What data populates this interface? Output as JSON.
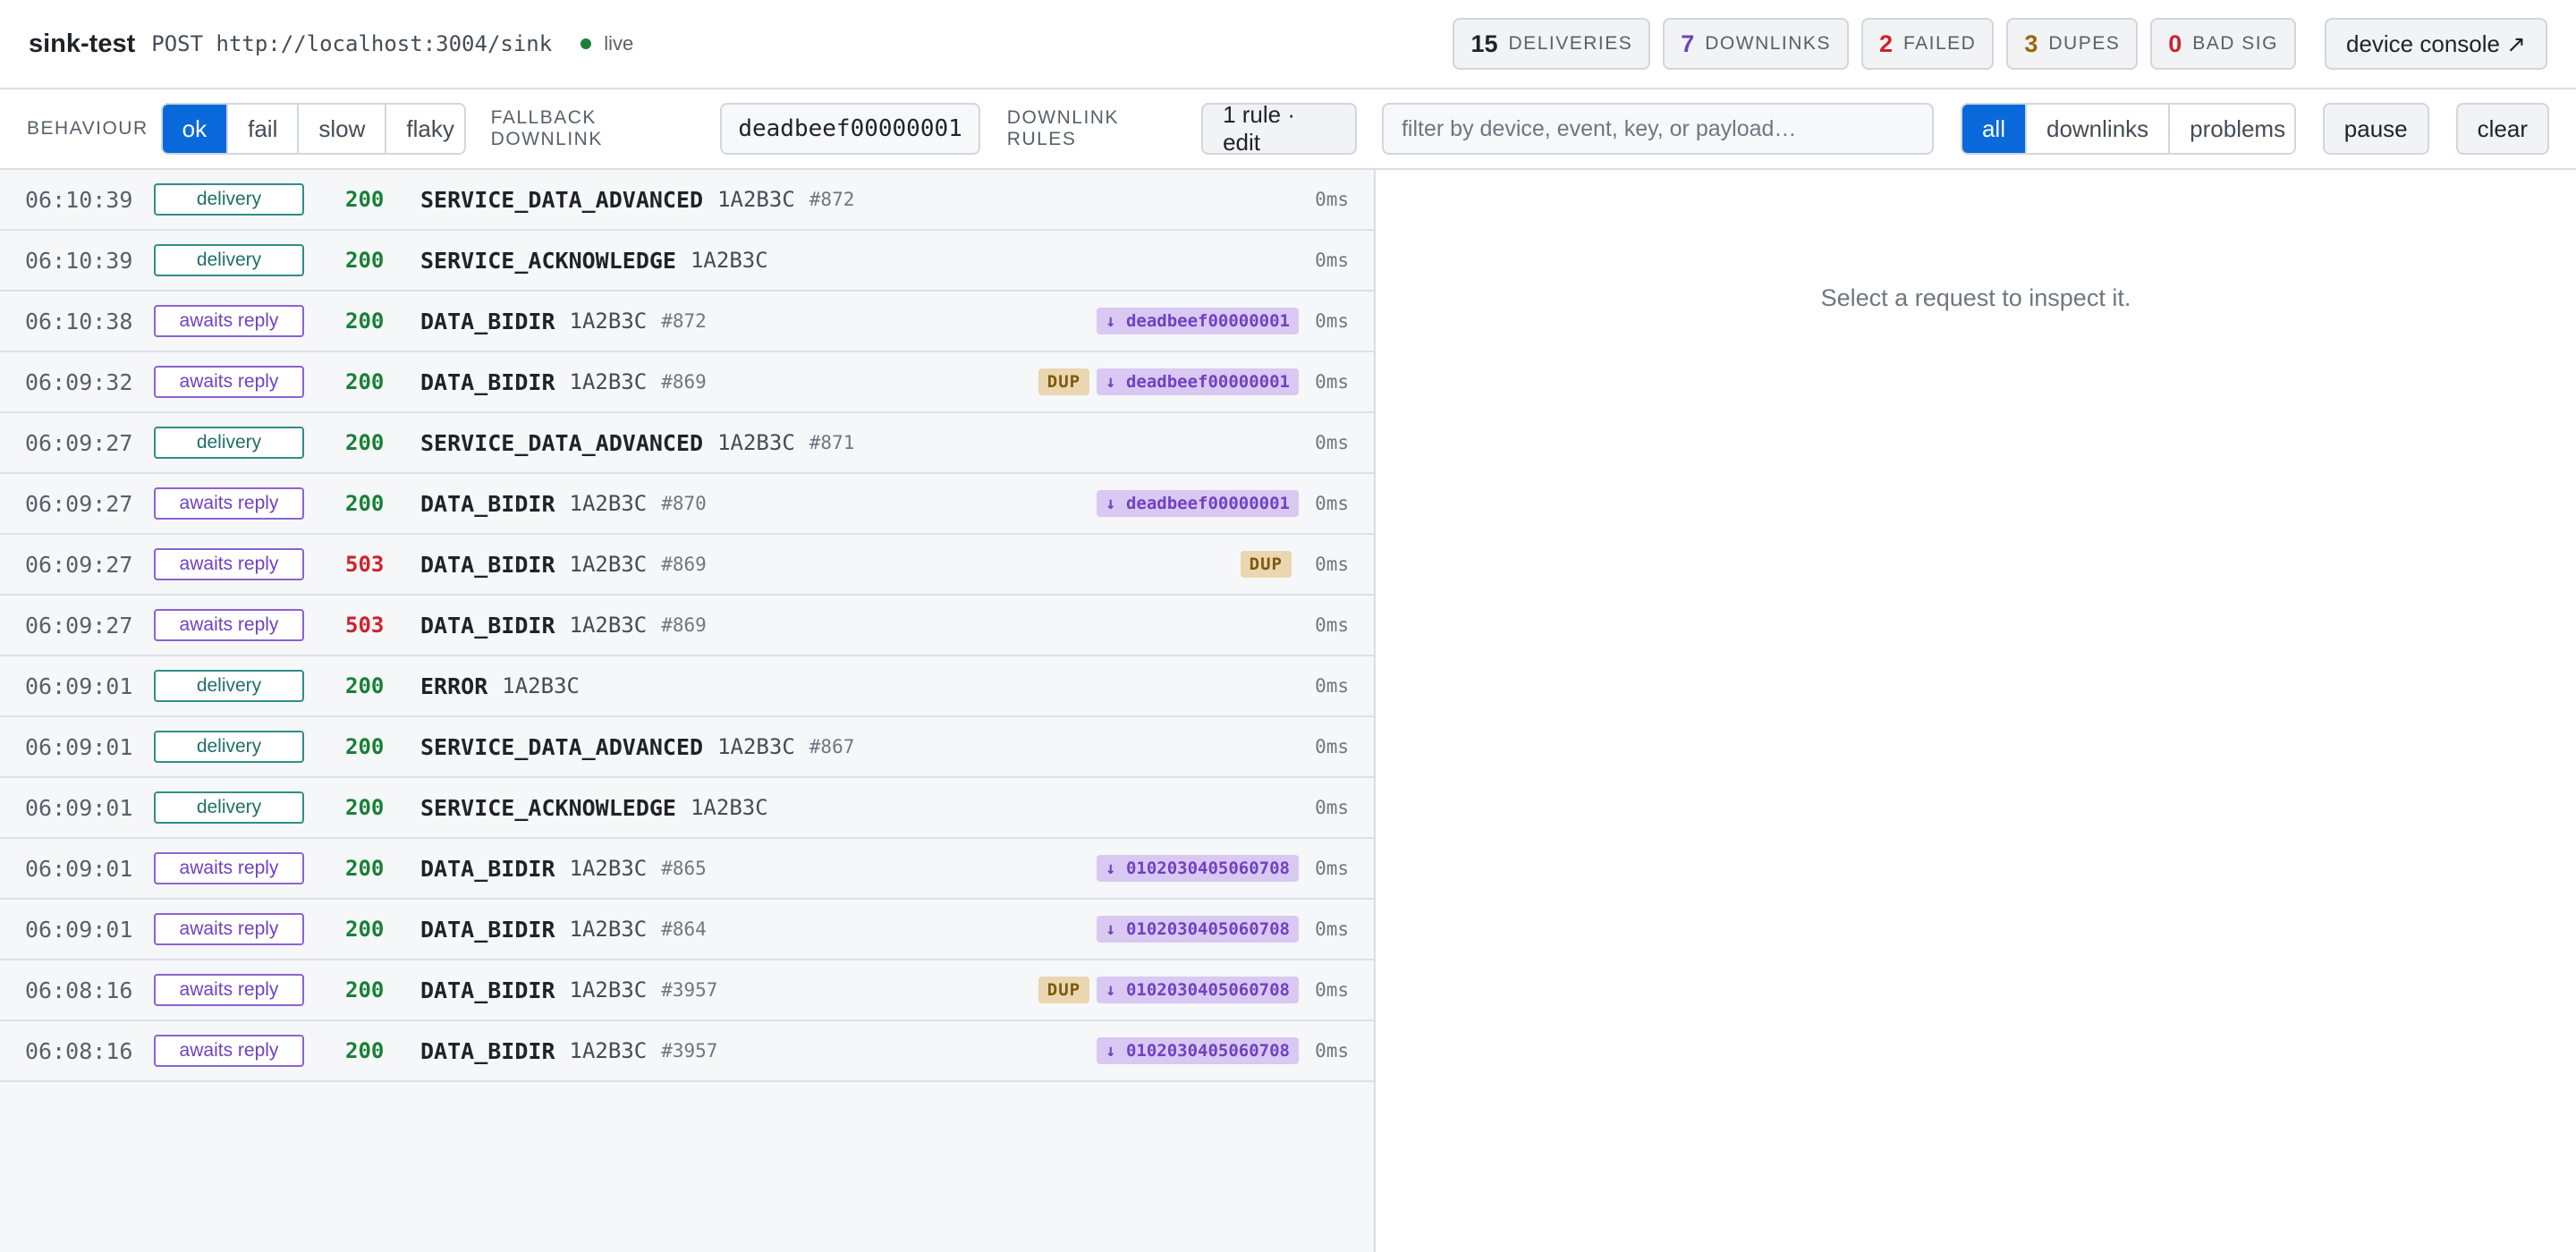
{
  "header": {
    "title": "sink-test",
    "endpoint": "POST http://localhost:3004/sink",
    "live_label": "live",
    "stats": [
      {
        "num": "15",
        "label": "DELIVERIES",
        "color": "#1f2328"
      },
      {
        "num": "7",
        "label": "DOWNLINKS",
        "color": "#6f42c1"
      },
      {
        "num": "2",
        "label": "FAILED",
        "color": "#cf222e"
      },
      {
        "num": "3",
        "label": "DUPES",
        "color": "#9a6700"
      },
      {
        "num": "0",
        "label": "BAD SIG",
        "color": "#cf222e"
      }
    ],
    "console_label": "device console ↗"
  },
  "toolbar": {
    "behaviour_label": "BEHAVIOUR",
    "behaviour_options": [
      "ok",
      "fail",
      "slow",
      "flaky"
    ],
    "behaviour_selected": "ok",
    "fallback_label": "FALLBACK DOWNLINK",
    "fallback_value": "deadbeef00000001",
    "rules_label": "DOWNLINK RULES",
    "rules_button": "1 rule · edit",
    "filter_placeholder": "filter by device, event, key, or payload…",
    "view_options": [
      "all",
      "downlinks",
      "problems"
    ],
    "view_selected": "all",
    "pause_label": "pause",
    "clear_label": "clear"
  },
  "requests": [
    {
      "time": "06:10:39",
      "kind": "delivery",
      "status": "200",
      "event": "SERVICE_DATA_ADVANCED",
      "device": "1A2B3C",
      "seq": "#872",
      "dup": false,
      "downlink": "",
      "duration": "0ms"
    },
    {
      "time": "06:10:39",
      "kind": "delivery",
      "status": "200",
      "event": "SERVICE_ACKNOWLEDGE",
      "device": "1A2B3C",
      "seq": "",
      "dup": false,
      "downlink": "",
      "duration": "0ms"
    },
    {
      "time": "06:10:38",
      "kind": "awaits reply",
      "status": "200",
      "event": "DATA_BIDIR",
      "device": "1A2B3C",
      "seq": "#872",
      "dup": false,
      "downlink": "↓ deadbeef00000001",
      "duration": "0ms"
    },
    {
      "time": "06:09:32",
      "kind": "awaits reply",
      "status": "200",
      "event": "DATA_BIDIR",
      "device": "1A2B3C",
      "seq": "#869",
      "dup": true,
      "downlink": "↓ deadbeef00000001",
      "duration": "0ms"
    },
    {
      "time": "06:09:27",
      "kind": "delivery",
      "status": "200",
      "event": "SERVICE_DATA_ADVANCED",
      "device": "1A2B3C",
      "seq": "#871",
      "dup": false,
      "downlink": "",
      "duration": "0ms"
    },
    {
      "time": "06:09:27",
      "kind": "awaits reply",
      "status": "200",
      "event": "DATA_BIDIR",
      "device": "1A2B3C",
      "seq": "#870",
      "dup": false,
      "downlink": "↓ deadbeef00000001",
      "duration": "0ms"
    },
    {
      "time": "06:09:27",
      "kind": "awaits reply",
      "status": "503",
      "event": "DATA_BIDIR",
      "device": "1A2B3C",
      "seq": "#869",
      "dup": true,
      "downlink": "",
      "duration": "0ms"
    },
    {
      "time": "06:09:27",
      "kind": "awaits reply",
      "status": "503",
      "event": "DATA_BIDIR",
      "device": "1A2B3C",
      "seq": "#869",
      "dup": false,
      "downlink": "",
      "duration": "0ms"
    },
    {
      "time": "06:09:01",
      "kind": "delivery",
      "status": "200",
      "event": "ERROR",
      "device": "1A2B3C",
      "seq": "",
      "dup": false,
      "downlink": "",
      "duration": "0ms"
    },
    {
      "time": "06:09:01",
      "kind": "delivery",
      "status": "200",
      "event": "SERVICE_DATA_ADVANCED",
      "device": "1A2B3C",
      "seq": "#867",
      "dup": false,
      "downlink": "",
      "duration": "0ms"
    },
    {
      "time": "06:09:01",
      "kind": "delivery",
      "status": "200",
      "event": "SERVICE_ACKNOWLEDGE",
      "device": "1A2B3C",
      "seq": "",
      "dup": false,
      "downlink": "",
      "duration": "0ms"
    },
    {
      "time": "06:09:01",
      "kind": "awaits reply",
      "status": "200",
      "event": "DATA_BIDIR",
      "device": "1A2B3C",
      "seq": "#865",
      "dup": false,
      "downlink": "↓ 0102030405060708",
      "duration": "0ms"
    },
    {
      "time": "06:09:01",
      "kind": "awaits reply",
      "status": "200",
      "event": "DATA_BIDIR",
      "device": "1A2B3C",
      "seq": "#864",
      "dup": false,
      "downlink": "↓ 0102030405060708",
      "duration": "0ms"
    },
    {
      "time": "06:08:16",
      "kind": "awaits reply",
      "status": "200",
      "event": "DATA_BIDIR",
      "device": "1A2B3C",
      "seq": "#3957",
      "dup": true,
      "downlink": "↓ 0102030405060708",
      "duration": "0ms"
    },
    {
      "time": "06:08:16",
      "kind": "awaits reply",
      "status": "200",
      "event": "DATA_BIDIR",
      "device": "1A2B3C",
      "seq": "#3957",
      "dup": false,
      "downlink": "↓ 0102030405060708",
      "duration": "0ms"
    }
  ],
  "dup_label": "DUP",
  "detail": {
    "placeholder": "Select a request to inspect it."
  }
}
